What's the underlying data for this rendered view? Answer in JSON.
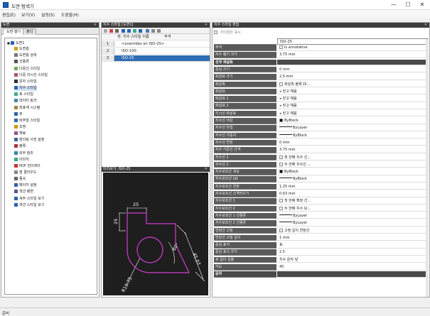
{
  "window": {
    "title": "도면 탐색기",
    "min": "—",
    "max": "☐",
    "close": "✕"
  },
  "menu": [
    "편집(E)",
    "보기(V)",
    "설정(S)",
    "도움말(H)"
  ],
  "left": {
    "title": "도면",
    "tabs": [
      "도면 열기",
      "폴더"
    ],
    "tree": [
      {
        "label": "도면1",
        "icon": "drawing-icon",
        "color": "#2a62b8"
      },
      {
        "label": "도면층",
        "icon": "layer-icon",
        "color": "#d4a017"
      },
      {
        "label": "도면층 상태",
        "icon": "layer-state-icon",
        "color": "#777"
      },
      {
        "label": "선종류",
        "icon": "linetype-icon",
        "color": "#555"
      },
      {
        "label": "다중선 스타일",
        "icon": "mline-icon",
        "color": "#7a5"
      },
      {
        "label": "다중 지시선 스타일",
        "icon": "mleader-icon",
        "color": "#a57"
      },
      {
        "label": "문자 스타일",
        "icon": "text-style-icon",
        "color": "#333"
      },
      {
        "label": "치수 스타일",
        "icon": "dim-style-icon",
        "color": "#2a62b8"
      },
      {
        "label": "표 스타일",
        "icon": "table-style-icon",
        "color": "#4a8"
      },
      {
        "label": "데이터 링크",
        "icon": "datalink-icon",
        "color": "#48a"
      },
      {
        "label": "좌표계 시스템",
        "icon": "ucs-icon",
        "color": "#a84"
      },
      {
        "label": "뷰",
        "icon": "view-icon",
        "color": "#2a62b8"
      },
      {
        "label": "비주얼 스타일",
        "icon": "visual-style-icon",
        "color": "#36a"
      },
      {
        "label": "조명",
        "icon": "light-icon",
        "color": "#c90"
      },
      {
        "label": "재료",
        "icon": "material-icon",
        "color": "#957"
      },
      {
        "label": "렌더링 사전 설정",
        "icon": "render-icon",
        "color": "#369"
      },
      {
        "label": "블록",
        "icon": "block-icon",
        "color": "#a33"
      },
      {
        "label": "외부 참조",
        "icon": "xref-icon",
        "color": "#38a"
      },
      {
        "label": "이미지",
        "icon": "image-icon",
        "color": "#3a8"
      },
      {
        "label": "PDF 언더레이",
        "icon": "pdf-icon",
        "color": "#c33"
      },
      {
        "label": "점 클라우드",
        "icon": "pointcloud-icon",
        "color": "#888"
      },
      {
        "label": "종속",
        "icon": "dependency-icon",
        "color": "#666"
      },
      {
        "label": "페이지 설정",
        "icon": "page-setup-icon",
        "color": "#2a62b8"
      },
      {
        "label": "섹션 평면",
        "icon": "section-icon",
        "color": "#558"
      },
      {
        "label": "세부 스타일 보기",
        "icon": "detail-icon",
        "color": "#2a62b8"
      },
      {
        "label": "섹션 스타일 보기",
        "icon": "section-view-icon",
        "color": "#2a62b8"
      }
    ],
    "selected_index": 7
  },
  "middle": {
    "title": "치수 스타일 [도면1]",
    "col_name": "현. 치수 스타일 이름",
    "col_note": "주석",
    "rows": [
      {
        "num": "1",
        "name": "<overrides on ISO-25>"
      },
      {
        "num": "2",
        "name": "ISO-100"
      },
      {
        "num": "3",
        "name": "ISO-25"
      }
    ],
    "preview_title": "미리보기: ISO-25",
    "dims": [
      "25",
      "25",
      "45.07",
      "60°",
      "R16.75"
    ]
  },
  "right": {
    "title": "치수 스타일 편집",
    "checkbox_label": "차이점만 표시",
    "name_value": "ISO-25",
    "props": [
      {
        "n": "주석",
        "v": "Is annotative",
        "type": "check"
      },
      {
        "n": "지수 램기 크기",
        "v": "3.75 mm"
      },
      {
        "n": "선과 화살표",
        "v": "",
        "type": "cat"
      },
      {
        "n": "중심 크기",
        "v": "0 mm"
      },
      {
        "n": "화살표 크기",
        "v": "2.5 mm"
      },
      {
        "n": "화살촉",
        "v": "화살촉 블록 DI...",
        "type": "check"
      },
      {
        "n": "화살표",
        "v": "닫고 채움",
        "type": "arrow"
      },
      {
        "n": "화살표 1",
        "v": "닫고 채움",
        "type": "arrow"
      },
      {
        "n": "화살표 2",
        "v": "닫고 채움",
        "type": "arrow"
      },
      {
        "n": "지시선 화살표",
        "v": "닫고 채움",
        "type": "arrow"
      },
      {
        "n": "지수선 색상",
        "v": "ByBlock",
        "type": "swatch"
      },
      {
        "n": "지수선 유형",
        "v": "ByLayer",
        "type": "line"
      },
      {
        "n": "지수선 가중치",
        "v": "ByBlock",
        "type": "line"
      },
      {
        "n": "지수선 연장",
        "v": "0 mm"
      },
      {
        "n": "지수 기준선 간격",
        "v": "3.75 mm"
      },
      {
        "n": "지수선 1",
        "v": "첫 번째 치수 선...",
        "type": "check"
      },
      {
        "n": "지수선 2",
        "v": "두 번째 치수선 ...",
        "type": "check"
      },
      {
        "n": "지수보조선 색상",
        "v": "ByBlock",
        "type": "swatch"
      },
      {
        "n": "지수보조선 LW",
        "v": "ByBlock",
        "type": "line"
      },
      {
        "n": "지수보조선 연장",
        "v": "1.25 mm"
      },
      {
        "n": "지수보조선 간격띄우기",
        "v": "0.63 mm"
      },
      {
        "n": "지수보조선 1",
        "v": "첫 번째 확장 선...",
        "type": "check"
      },
      {
        "n": "지수보조선 2",
        "v": "두 번째 치수 보...",
        "type": "check"
      },
      {
        "n": "지수보조선 1 선종류",
        "v": "ByLayer",
        "type": "line"
      },
      {
        "n": "지수보조선 2 선종류",
        "v": "ByLayer",
        "type": "line"
      },
      {
        "n": "연장선 고정",
        "v": "고정 길이 연장선",
        "type": "check"
      },
      {
        "n": "연장선 고정 길이",
        "v": "1 mm"
      },
      {
        "n": "중심 표식",
        "v": "표"
      },
      {
        "n": "중심 표시 크기",
        "v": "2.5"
      },
      {
        "n": "호 길이 심볼",
        "v": "치수 문자 앞"
      },
      {
        "n": "각도",
        "v": "45"
      },
      {
        "n": "문자",
        "v": "",
        "type": "cat"
      }
    ]
  },
  "status": "준비"
}
